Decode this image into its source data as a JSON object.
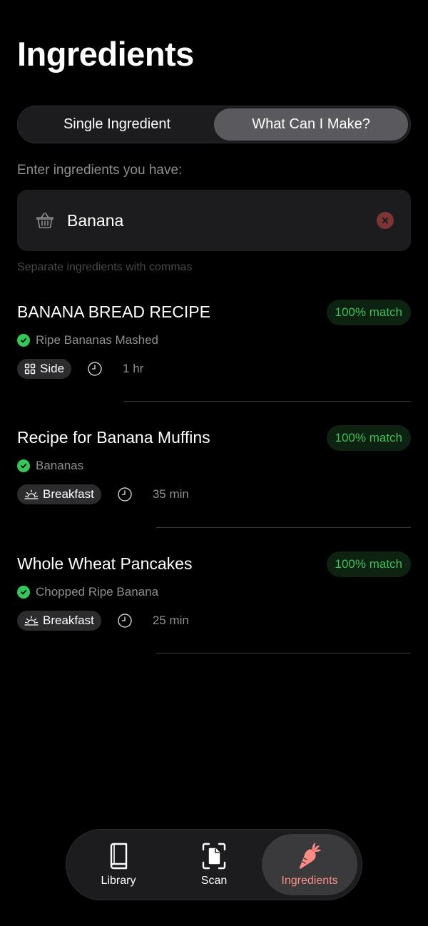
{
  "header": {
    "title": "Ingredients"
  },
  "segments": {
    "items": [
      "Single Ingredient",
      "What Can I Make?"
    ],
    "selected": "What Can I Make?"
  },
  "search": {
    "label": "Enter ingredients you have:",
    "value": "Banana",
    "hint": "Separate ingredients with commas"
  },
  "recipes": [
    {
      "title": "BANANA BREAD RECIPE",
      "match": "100% match",
      "ingredient": "Ripe Bananas Mashed",
      "tag": "Side",
      "tag_icon": "grid-icon",
      "time": "1 hr"
    },
    {
      "title": "Recipe for Banana Muffins",
      "match": "100% match",
      "ingredient": "Bananas",
      "tag": "Breakfast",
      "tag_icon": "sunrise-icon",
      "time": "35 min"
    },
    {
      "title": "Whole Wheat Pancakes",
      "match": "100% match",
      "ingredient": "Chopped Ripe Banana",
      "tag": "Breakfast",
      "tag_icon": "sunrise-icon",
      "time": "25 min"
    }
  ],
  "tabbar": {
    "items": [
      {
        "label": "Library",
        "icon": "book-icon"
      },
      {
        "label": "Scan",
        "icon": "scan-document-icon"
      },
      {
        "label": "Ingredients",
        "icon": "carrot-icon"
      }
    ],
    "selected": "Ingredients"
  },
  "colors": {
    "accent": "#ff8b85",
    "match_green": "#3fbf5c",
    "check_green": "#34c759",
    "clear_red": "#7a3534"
  }
}
